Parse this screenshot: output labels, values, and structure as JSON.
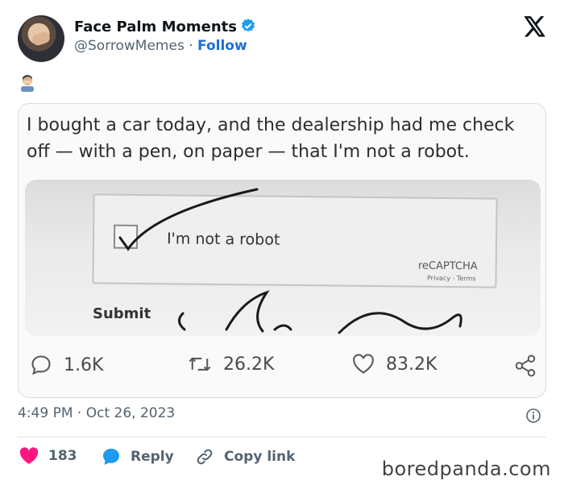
{
  "author": {
    "name": "Face Palm Moments",
    "handle": "@SorrowMemes",
    "separator": "·",
    "follow_label": "Follow"
  },
  "post": {
    "emoji": "face-palm-emoji"
  },
  "quoted": {
    "text": "I bought a car today, and the dealership had me check off — with a pen, on paper — that I'm not a robot.",
    "captcha_label": "I'm not a robot",
    "recaptcha_brand": "reCAPTCHA",
    "privacy_terms": "Privacy - Terms",
    "submit_label": "Submit",
    "stats": {
      "replies": "1.6K",
      "reposts": "26.2K",
      "likes": "83.2K"
    }
  },
  "timestamp": {
    "time": "4:49 PM",
    "separator": "·",
    "date": "Oct 26, 2023"
  },
  "actions": {
    "like_count": "183",
    "reply_label": "Reply",
    "copy_link_label": "Copy link"
  },
  "watermark": "boredpanda.com",
  "colors": {
    "follow": "#1d6fd6",
    "verified": "#1d9bf0",
    "heart": "#f91880",
    "reply_bubble": "#1d9bf0"
  }
}
